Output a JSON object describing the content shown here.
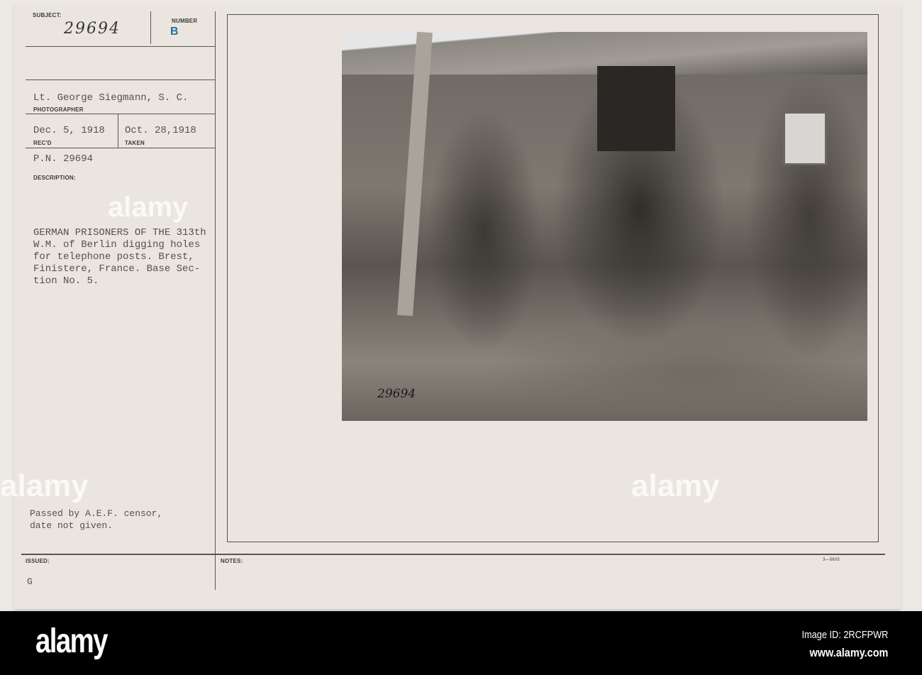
{
  "card": {
    "subject_label": "SUBJECT:",
    "subject_value": "29694",
    "number_label": "NUMBER",
    "number_value": "B",
    "photographer_value": "Lt. George Siegmann, S. C.",
    "photographer_label": "PHOTOGRAPHER",
    "recd_value": "Dec. 5, 1918",
    "recd_label": "REC'D",
    "taken_value": "Oct. 28,1918",
    "taken_label": "TAKEN",
    "pn_value": "P.N. 29694",
    "description_label": "DESCRIPTION:",
    "description_lines": [
      "GERMAN PRISONERS OF THE 313th",
      "W.M. of Berlin digging holes",
      "for telephone posts. Brest,",
      "Finistere, France. Base Sec-",
      "tion No. 5."
    ],
    "censor_lines": [
      "Passed by A.E.F. censor,",
      "date not given."
    ],
    "issued_label": "ISSUED:",
    "issued_value": "G",
    "notes_label": "NOTES:",
    "form_number": "3—5605",
    "photo_stamp_number": "29694"
  },
  "footer": {
    "logo": "alamy",
    "image_id": "Image ID: 2RCFPWR",
    "url": "www.alamy.com"
  },
  "watermark": "alamy"
}
